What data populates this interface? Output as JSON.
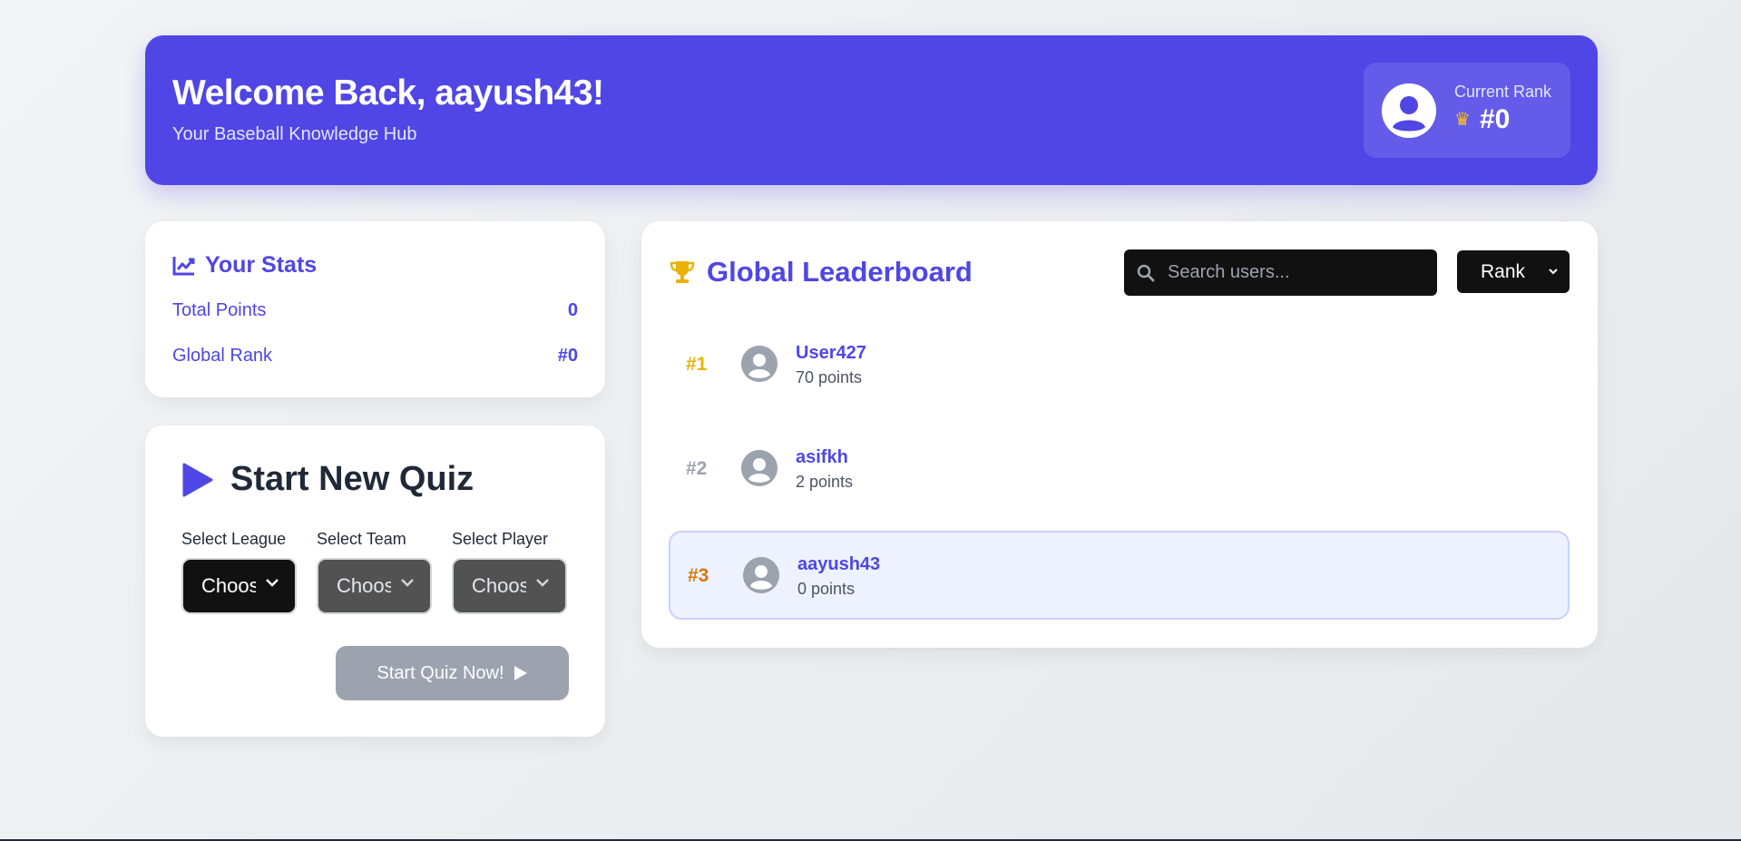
{
  "header": {
    "welcome": "Welcome Back, aayush43!",
    "tagline": "Your Baseball Knowledge Hub",
    "rank_label": "Current Rank",
    "rank_value": "#0"
  },
  "stats": {
    "title": "Your Stats",
    "rows": [
      {
        "label": "Total Points",
        "value": "0"
      },
      {
        "label": "Global Rank",
        "value": "#0"
      }
    ]
  },
  "quiz": {
    "title": "Start New Quiz",
    "selects": [
      {
        "label": "Select League",
        "value": "Choose"
      },
      {
        "label": "Select Team",
        "value": "Choose"
      },
      {
        "label": "Select Player",
        "value": "Choose"
      }
    ],
    "start_button": "Start Quiz Now!"
  },
  "leaderboard": {
    "title": "Global Leaderboard",
    "search_placeholder": "Search users...",
    "sort_value": "Rank",
    "rows": [
      {
        "rank": "#1",
        "name": "User427",
        "points": "70 points"
      },
      {
        "rank": "#2",
        "name": "asifkh",
        "points": "2 points"
      },
      {
        "rank": "#3",
        "name": "aayush43",
        "points": "0 points"
      }
    ]
  },
  "colors": {
    "primary": "#4f46e5",
    "gold": "#eab308",
    "silver": "#9ca3af",
    "bronze": "#d97706",
    "highlight_row": "#eef2ff"
  },
  "icons": {
    "stats": "chart-line-icon",
    "quiz": "play-icon",
    "leaderboard": "trophy-icon",
    "search": "search-icon",
    "rank": "crown-icon"
  }
}
